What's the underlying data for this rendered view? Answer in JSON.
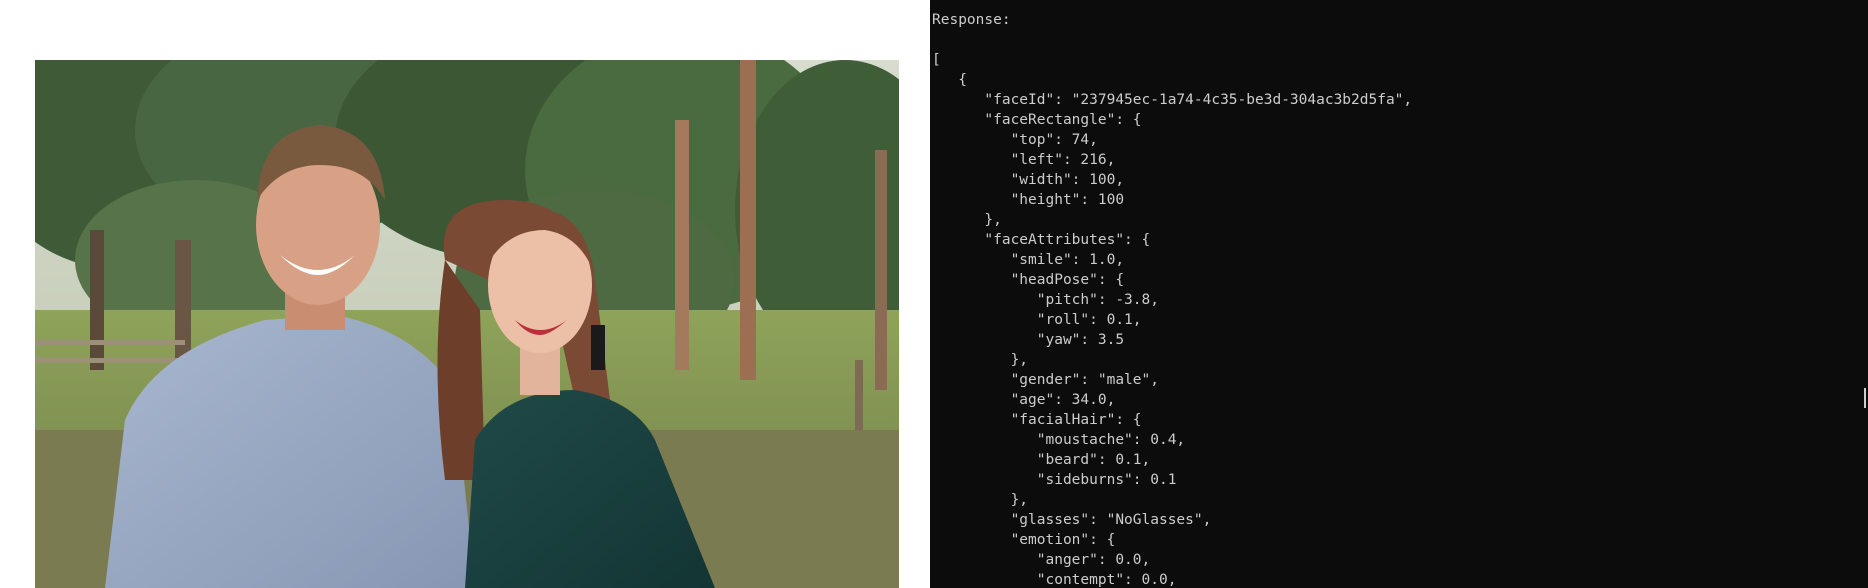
{
  "photo": {
    "alt": "Photo of a smiling man in a light blue shirt and a smiling woman in a dark green dress standing outdoors in front of eucalyptus trees"
  },
  "console": {
    "lines": [
      "Response:",
      "",
      "[",
      "   {",
      "      \"faceId\": \"237945ec-1a74-4c35-be3d-304ac3b2d5fa\",",
      "      \"faceRectangle\": {",
      "         \"top\": 74,",
      "         \"left\": 216,",
      "         \"width\": 100,",
      "         \"height\": 100",
      "      },",
      "      \"faceAttributes\": {",
      "         \"smile\": 1.0,",
      "         \"headPose\": {",
      "            \"pitch\": -3.8,",
      "            \"roll\": 0.1,",
      "            \"yaw\": 3.5",
      "         },",
      "         \"gender\": \"male\",",
      "         \"age\": 34.0,",
      "         \"facialHair\": {",
      "            \"moustache\": 0.4,",
      "            \"beard\": 0.1,",
      "            \"sideburns\": 0.1",
      "         },",
      "         \"glasses\": \"NoGlasses\",",
      "         \"emotion\": {",
      "            \"anger\": 0.0,",
      "            \"contempt\": 0.0,"
    ]
  },
  "colors": {
    "console_bg": "#0c0c0c",
    "console_text": "#cccccc"
  }
}
